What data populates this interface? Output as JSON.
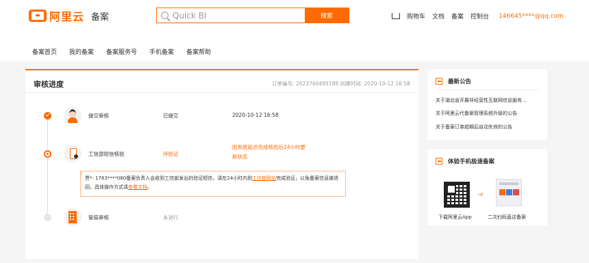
{
  "header": {
    "logo_text": "阿里云",
    "logo_sub": "备案",
    "search_value": "Quick BI",
    "search_button": "搜索",
    "links": {
      "cart": "购物车",
      "docs": "文档",
      "beian": "备案",
      "console": "控制台",
      "email": "146645****@qq.com"
    },
    "icons": [
      "search-icon",
      "cart-icon"
    ]
  },
  "nav": [
    "备案首页",
    "我的备案",
    "备案服务号",
    "手机备案",
    "备案帮助"
  ],
  "main": {
    "title": "审核进度",
    "order_info": "订单编号: 2023760495188  创建时间: 2020-10-12 16:58",
    "steps": [
      {
        "name": "提交审核",
        "status": "已提交",
        "time": "2020-10-12 16:58",
        "state": "done"
      },
      {
        "name": "工信部短信核验",
        "status": "待验证",
        "note": "因系统延迟完成核验后24小时更新状态",
        "state": "current"
      },
      {
        "name": "管局审核",
        "status": "未进行",
        "state": "pending"
      }
    ],
    "tip": {
      "text_1": "贾*: 1763****080备案负责人会收到工信部发出的验证短信，请在24小时内到",
      "link_1": "工信部网站",
      "text_2": "完成验证，以免备案信息被退回，具体操作方式请",
      "link_2": "查看文档",
      "text_3": "。"
    }
  },
  "sidebar": {
    "notices_title": "最新公告",
    "notices": [
      "关于湖北省开展非经营性互联网信息服务...",
      "关于阿里云代备案管理系统升级的公告",
      "关于备案订单超期后自动失效的公告"
    ],
    "mobile_title": "体验手机极速备案",
    "mobile_caption_1": "下载阿里云App",
    "mobile_caption_2": "二次扫码直达备案"
  },
  "colors": {
    "accent": "#ff6a00",
    "background": "#f5f5f6"
  }
}
